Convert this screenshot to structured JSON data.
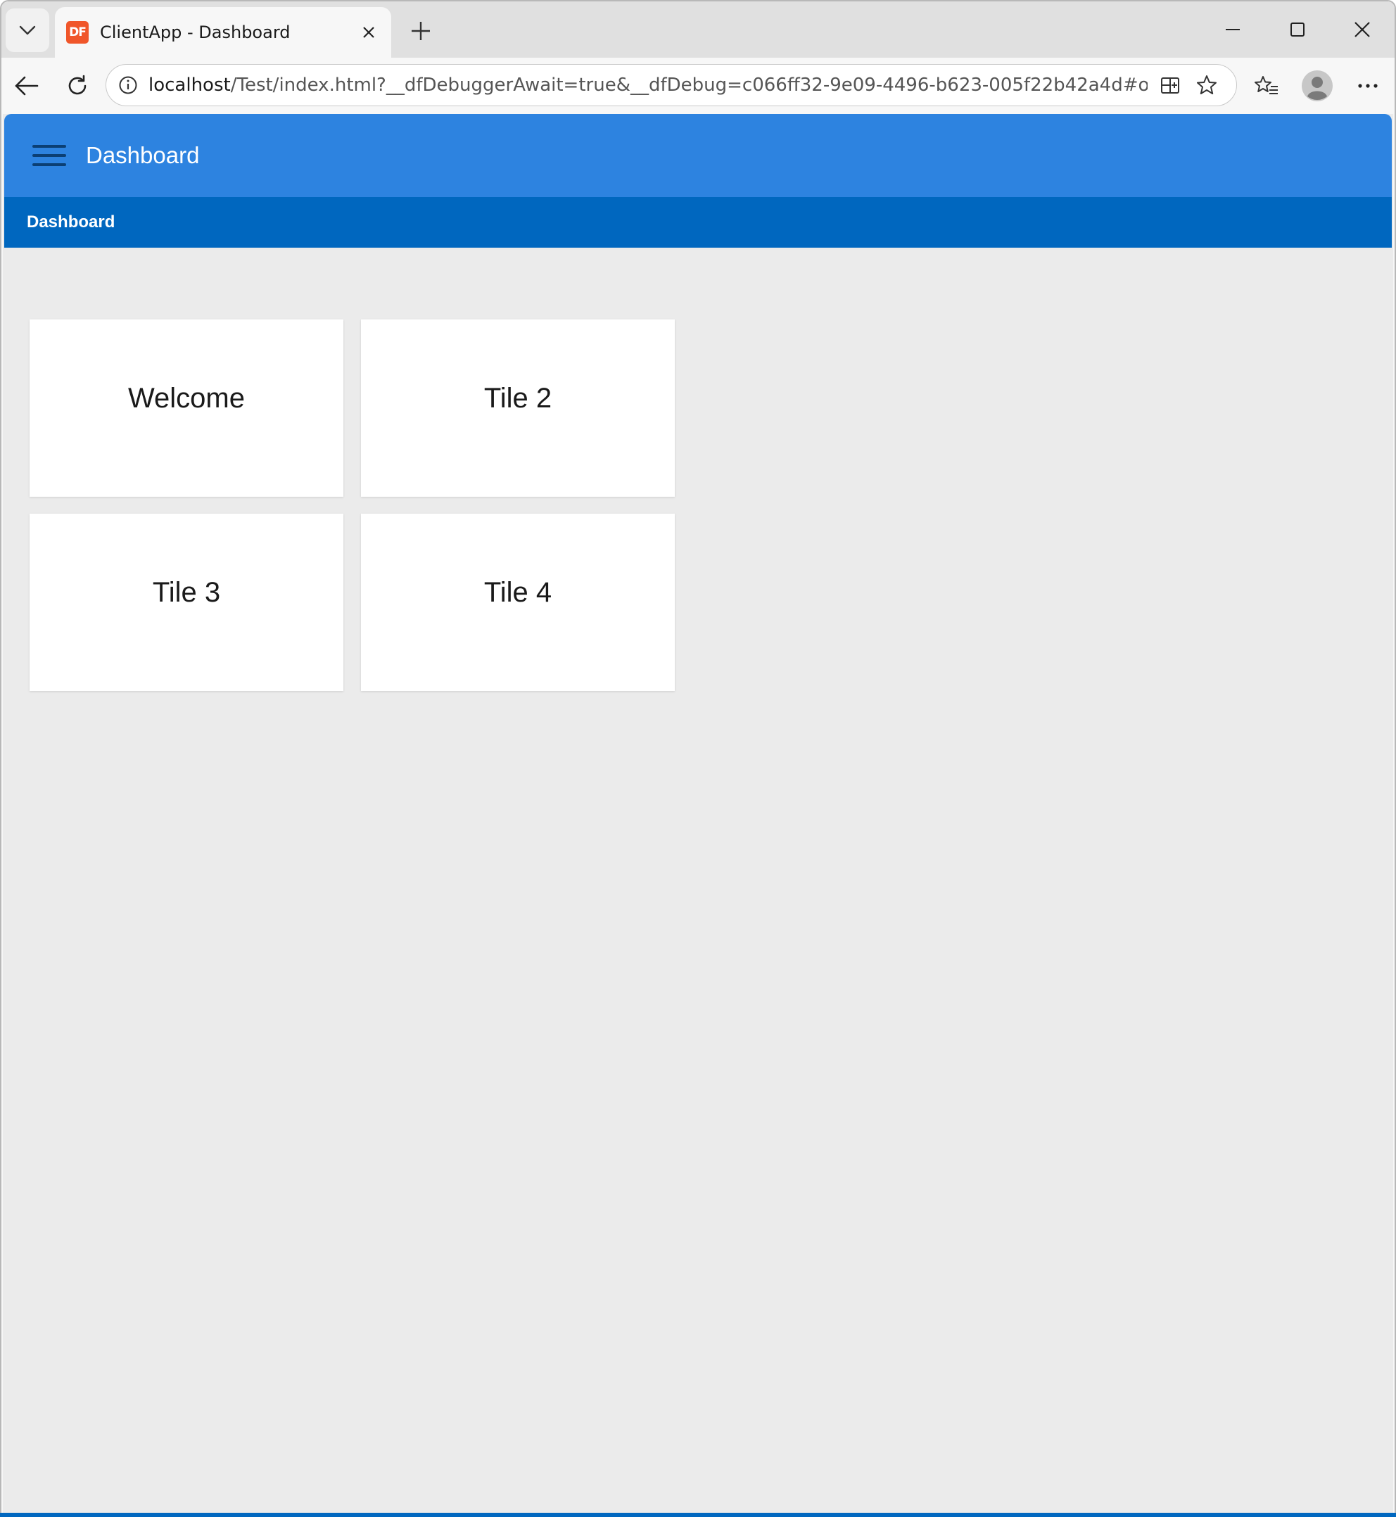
{
  "browser": {
    "tab": {
      "favicon_text": "DF",
      "title": "ClientApp - Dashboard"
    },
    "address": {
      "host": "localhost",
      "path": "/Test/index.html?__dfDebuggerAwait=true&__dfDebug=c066ff32-9e09-4496-b623-005f22b42a4d#oDas..."
    }
  },
  "app": {
    "header_title": "Dashboard",
    "breadcrumb": "Dashboard",
    "tiles": [
      {
        "label": "Welcome"
      },
      {
        "label": "Tile 2"
      },
      {
        "label": "Tile 3"
      },
      {
        "label": "Tile 4"
      }
    ]
  },
  "colors": {
    "header": "#2d83e0",
    "breadcrumb_bar": "#0067bf",
    "content_bg": "#ebebeb",
    "favicon": "#f0562a"
  }
}
